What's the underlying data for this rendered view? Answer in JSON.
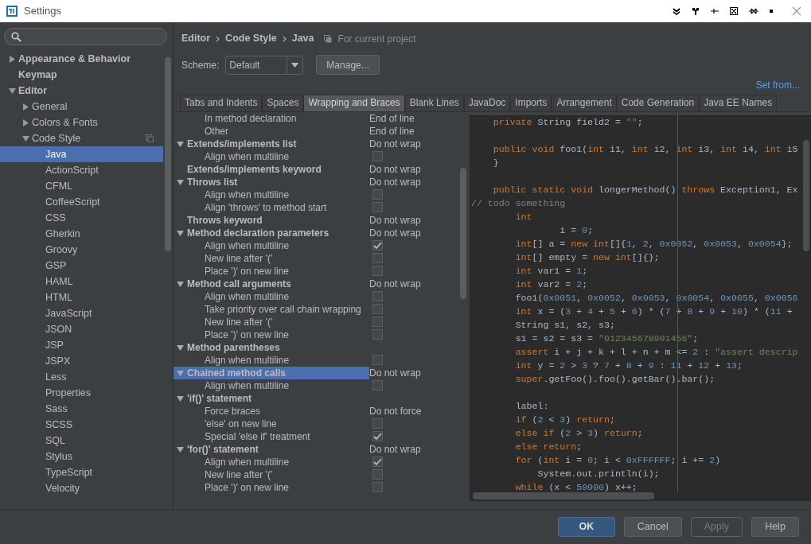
{
  "window": {
    "title": "Settings"
  },
  "sidebar": {
    "items": [
      {
        "label": "Appearance & Behavior",
        "expanded": false,
        "selected": false
      },
      {
        "label": "Keymap",
        "selected": false
      },
      {
        "label": "Editor",
        "expanded": true,
        "selected": false,
        "children": [
          {
            "label": "General",
            "expanded": false,
            "selected": false
          },
          {
            "label": "Colors & Fonts",
            "expanded": false,
            "selected": false
          },
          {
            "label": "Code Style",
            "expanded": true,
            "per_project": true,
            "selected": false,
            "children": [
              {
                "label": "Java",
                "selected": true
              },
              {
                "label": "ActionScript",
                "selected": false
              },
              {
                "label": "CFML",
                "selected": false
              },
              {
                "label": "CoffeeScript",
                "selected": false
              },
              {
                "label": "CSS",
                "selected": false
              },
              {
                "label": "Gherkin",
                "selected": false
              },
              {
                "label": "Groovy",
                "selected": false
              },
              {
                "label": "GSP",
                "selected": false
              },
              {
                "label": "HAML",
                "selected": false
              },
              {
                "label": "HTML",
                "selected": false
              },
              {
                "label": "JavaScript",
                "selected": false
              },
              {
                "label": "JSON",
                "selected": false
              },
              {
                "label": "JSP",
                "selected": false
              },
              {
                "label": "JSPX",
                "selected": false
              },
              {
                "label": "Less",
                "selected": false
              },
              {
                "label": "Properties",
                "selected": false
              },
              {
                "label": "Sass",
                "selected": false
              },
              {
                "label": "SCSS",
                "selected": false
              },
              {
                "label": "SQL",
                "selected": false
              },
              {
                "label": "Stylus",
                "selected": false
              },
              {
                "label": "TypeScript",
                "selected": false
              },
              {
                "label": "Velocity",
                "selected": false
              }
            ]
          }
        ]
      }
    ]
  },
  "breadcrumb": [
    "Editor",
    "Code Style",
    "Java"
  ],
  "scope_note": "For current project",
  "scheme": {
    "label": "Scheme:",
    "value": "Default",
    "manage_button": "Manage..."
  },
  "set_from_link": "Set from...",
  "tabs": [
    {
      "label": "Tabs and Indents",
      "selected": false
    },
    {
      "label": "Spaces",
      "selected": false
    },
    {
      "label": "Wrapping and Braces",
      "selected": true
    },
    {
      "label": "Blank Lines",
      "selected": false
    },
    {
      "label": "JavaDoc",
      "selected": false
    },
    {
      "label": "Imports",
      "selected": false
    },
    {
      "label": "Arrangement",
      "selected": false
    },
    {
      "label": "Code Generation",
      "selected": false
    },
    {
      "label": "Java EE Names",
      "selected": false
    }
  ],
  "wrapping_options": [
    {
      "children": [
        {
          "label": "In method declaration",
          "kind": "choice",
          "value": "End of line",
          "selected": false
        },
        {
          "label": "Other",
          "kind": "choice",
          "value": "End of line",
          "selected": false
        }
      ]
    },
    {
      "label": "Extends/implements list",
      "value": "Do not wrap",
      "expanded": true,
      "selected": false,
      "children": [
        {
          "label": "Align when multiline",
          "kind": "checkbox",
          "checked": false,
          "selected": false
        }
      ]
    },
    {
      "label": "Extends/implements keyword",
      "value": "Do not wrap",
      "selected": false
    },
    {
      "label": "Throws list",
      "value": "Do not wrap",
      "expanded": true,
      "selected": false,
      "children": [
        {
          "label": "Align when multiline",
          "kind": "checkbox",
          "checked": false,
          "selected": false
        },
        {
          "label": "Align 'throws' to method start",
          "kind": "checkbox",
          "checked": false,
          "selected": false
        }
      ]
    },
    {
      "label": "Throws keyword",
      "value": "Do not wrap",
      "selected": false
    },
    {
      "label": "Method declaration parameters",
      "value": "Do not wrap",
      "expanded": true,
      "selected": false,
      "children": [
        {
          "label": "Align when multiline",
          "kind": "checkbox",
          "checked": true,
          "selected": false
        },
        {
          "label": "New line after '('",
          "kind": "checkbox",
          "checked": false,
          "selected": false
        },
        {
          "label": "Place ')' on new line",
          "kind": "checkbox",
          "checked": false,
          "selected": false
        }
      ]
    },
    {
      "label": "Method call arguments",
      "value": "Do not wrap",
      "expanded": true,
      "selected": false,
      "children": [
        {
          "label": "Align when multiline",
          "kind": "checkbox",
          "checked": false,
          "selected": false
        },
        {
          "label": "Take priority over call chain wrapping",
          "kind": "checkbox",
          "checked": false,
          "selected": false
        },
        {
          "label": "New line after '('",
          "kind": "checkbox",
          "checked": false,
          "selected": false
        },
        {
          "label": "Place ')' on new line",
          "kind": "checkbox",
          "checked": false,
          "selected": false
        }
      ]
    },
    {
      "label": "Method parentheses",
      "expanded": true,
      "selected": false,
      "children": [
        {
          "label": "Align when multiline",
          "kind": "checkbox",
          "checked": false,
          "selected": false
        }
      ]
    },
    {
      "label": "Chained method calls",
      "value": "Do not wrap",
      "expanded": true,
      "selected": true,
      "children": [
        {
          "label": "Align when multiline",
          "kind": "checkbox",
          "checked": false,
          "selected": false
        }
      ]
    },
    {
      "label": "'if()' statement",
      "expanded": true,
      "selected": false,
      "children": [
        {
          "label": "Force braces",
          "kind": "choice",
          "value": "Do not force",
          "selected": false
        },
        {
          "label": "'else' on new line",
          "kind": "checkbox",
          "checked": false,
          "selected": false
        },
        {
          "label": "Special 'else if' treatment",
          "kind": "checkbox",
          "checked": true,
          "selected": false
        }
      ]
    },
    {
      "label": "'for()' statement",
      "value": "Do not wrap",
      "expanded": true,
      "selected": false,
      "children": [
        {
          "label": "Align when multiline",
          "kind": "checkbox",
          "checked": true,
          "selected": false
        },
        {
          "label": "New line after '('",
          "kind": "checkbox",
          "checked": false,
          "selected": false
        },
        {
          "label": "Place ')' on new line",
          "kind": "checkbox",
          "checked": false,
          "selected": false
        }
      ]
    }
  ],
  "code_preview": [
    {
      "kind": "code",
      "tokens": [
        {
          "kind": "keyword",
          "text": "    private"
        },
        {
          "kind": "plain",
          "text": " String field2 = "
        },
        {
          "kind": "string",
          "text": "\"\""
        },
        {
          "kind": "plain",
          "text": ";"
        }
      ]
    },
    {
      "kind": "blank"
    },
    {
      "kind": "code",
      "tokens": [
        {
          "kind": "keyword",
          "text": "    public void"
        },
        {
          "kind": "plain",
          "text": " foo1("
        },
        {
          "kind": "keyword",
          "text": "int"
        },
        {
          "kind": "plain",
          "text": " i1, "
        },
        {
          "kind": "keyword",
          "text": "int"
        },
        {
          "kind": "plain",
          "text": " i2, "
        },
        {
          "kind": "keyword",
          "text": "int"
        },
        {
          "kind": "plain",
          "text": " i3, "
        },
        {
          "kind": "keyword",
          "text": "int"
        },
        {
          "kind": "plain",
          "text": " i4, "
        },
        {
          "kind": "keyword",
          "text": "int"
        },
        {
          "kind": "plain",
          "text": " i5"
        }
      ]
    },
    {
      "kind": "code",
      "tokens": [
        {
          "kind": "plain",
          "text": "    }"
        }
      ]
    },
    {
      "kind": "blank"
    },
    {
      "kind": "code",
      "tokens": [
        {
          "kind": "keyword",
          "text": "    public static void"
        },
        {
          "kind": "plain",
          "text": " longerMethod() "
        },
        {
          "kind": "keyword",
          "text": "throws"
        },
        {
          "kind": "plain",
          "text": " Exception1, Ex"
        }
      ]
    },
    {
      "kind": "code",
      "tokens": [
        {
          "kind": "comment",
          "text": "// todo something"
        }
      ]
    },
    {
      "kind": "code",
      "tokens": [
        {
          "kind": "keyword",
          "text": "        int"
        }
      ]
    },
    {
      "kind": "code",
      "tokens": [
        {
          "kind": "plain",
          "text": "                i = "
        },
        {
          "kind": "number",
          "text": "0"
        },
        {
          "kind": "plain",
          "text": ";"
        }
      ]
    },
    {
      "kind": "code",
      "tokens": [
        {
          "kind": "keyword",
          "text": "        int"
        },
        {
          "kind": "plain",
          "text": "[] a = "
        },
        {
          "kind": "keyword",
          "text": "new int"
        },
        {
          "kind": "plain",
          "text": "[]{"
        },
        {
          "kind": "number",
          "text": "1"
        },
        {
          "kind": "plain",
          "text": ", "
        },
        {
          "kind": "number",
          "text": "2"
        },
        {
          "kind": "plain",
          "text": ", "
        },
        {
          "kind": "number",
          "text": "0x0052"
        },
        {
          "kind": "plain",
          "text": ", "
        },
        {
          "kind": "number",
          "text": "0x0053"
        },
        {
          "kind": "plain",
          "text": ", "
        },
        {
          "kind": "number",
          "text": "0x0054"
        },
        {
          "kind": "plain",
          "text": "};"
        }
      ]
    },
    {
      "kind": "code",
      "tokens": [
        {
          "kind": "keyword",
          "text": "        int"
        },
        {
          "kind": "plain",
          "text": "[] empty = "
        },
        {
          "kind": "keyword",
          "text": "new int"
        },
        {
          "kind": "plain",
          "text": "[]{};"
        }
      ]
    },
    {
      "kind": "code",
      "tokens": [
        {
          "kind": "keyword",
          "text": "        int"
        },
        {
          "kind": "plain",
          "text": " var1 = "
        },
        {
          "kind": "number",
          "text": "1"
        },
        {
          "kind": "plain",
          "text": ";"
        }
      ]
    },
    {
      "kind": "code",
      "tokens": [
        {
          "kind": "keyword",
          "text": "        int"
        },
        {
          "kind": "plain",
          "text": " var2 = "
        },
        {
          "kind": "number",
          "text": "2"
        },
        {
          "kind": "plain",
          "text": ";"
        }
      ]
    },
    {
      "kind": "code",
      "tokens": [
        {
          "kind": "plain",
          "text": "        foo1("
        },
        {
          "kind": "number",
          "text": "0x0051"
        },
        {
          "kind": "plain",
          "text": ", "
        },
        {
          "kind": "number",
          "text": "0x0052"
        },
        {
          "kind": "plain",
          "text": ", "
        },
        {
          "kind": "number",
          "text": "0x0053"
        },
        {
          "kind": "plain",
          "text": ", "
        },
        {
          "kind": "number",
          "text": "0x0054"
        },
        {
          "kind": "plain",
          "text": ", "
        },
        {
          "kind": "number",
          "text": "0x0055"
        },
        {
          "kind": "plain",
          "text": ", "
        },
        {
          "kind": "number",
          "text": "0x0056"
        }
      ]
    },
    {
      "kind": "code",
      "tokens": [
        {
          "kind": "keyword",
          "text": "        int"
        },
        {
          "kind": "plain",
          "text": " x = ("
        },
        {
          "kind": "number",
          "text": "3"
        },
        {
          "kind": "plain",
          "text": " + "
        },
        {
          "kind": "number",
          "text": "4"
        },
        {
          "kind": "plain",
          "text": " + "
        },
        {
          "kind": "number",
          "text": "5"
        },
        {
          "kind": "plain",
          "text": " + "
        },
        {
          "kind": "number",
          "text": "6"
        },
        {
          "kind": "plain",
          "text": ") * ("
        },
        {
          "kind": "number",
          "text": "7"
        },
        {
          "kind": "plain",
          "text": " + "
        },
        {
          "kind": "number",
          "text": "8"
        },
        {
          "kind": "plain",
          "text": " + "
        },
        {
          "kind": "number",
          "text": "9"
        },
        {
          "kind": "plain",
          "text": " + "
        },
        {
          "kind": "number",
          "text": "10"
        },
        {
          "kind": "plain",
          "text": ") * ("
        },
        {
          "kind": "number",
          "text": "11"
        },
        {
          "kind": "plain",
          "text": " +"
        }
      ]
    },
    {
      "kind": "code",
      "tokens": [
        {
          "kind": "plain",
          "text": "        String s1, s2, s3;"
        }
      ]
    },
    {
      "kind": "code",
      "tokens": [
        {
          "kind": "plain",
          "text": "        s1 = s2 = s3 = "
        },
        {
          "kind": "string",
          "text": "\"012345678901456\""
        },
        {
          "kind": "plain",
          "text": ";"
        }
      ]
    },
    {
      "kind": "code",
      "tokens": [
        {
          "kind": "keyword",
          "text": "        assert"
        },
        {
          "kind": "plain",
          "text": " i + j + k + l + n + m <= "
        },
        {
          "kind": "number",
          "text": "2"
        },
        {
          "kind": "plain",
          "text": " : "
        },
        {
          "kind": "string",
          "text": "\"assert descrip"
        }
      ]
    },
    {
      "kind": "code",
      "tokens": [
        {
          "kind": "keyword",
          "text": "        int"
        },
        {
          "kind": "plain",
          "text": " y = "
        },
        {
          "kind": "number",
          "text": "2"
        },
        {
          "kind": "plain",
          "text": " > "
        },
        {
          "kind": "number",
          "text": "3"
        },
        {
          "kind": "plain",
          "text": " ? "
        },
        {
          "kind": "number",
          "text": "7"
        },
        {
          "kind": "plain",
          "text": " + "
        },
        {
          "kind": "number",
          "text": "8"
        },
        {
          "kind": "plain",
          "text": " + "
        },
        {
          "kind": "number",
          "text": "9"
        },
        {
          "kind": "plain",
          "text": " : "
        },
        {
          "kind": "number",
          "text": "11"
        },
        {
          "kind": "plain",
          "text": " + "
        },
        {
          "kind": "number",
          "text": "12"
        },
        {
          "kind": "plain",
          "text": " + "
        },
        {
          "kind": "number",
          "text": "13"
        },
        {
          "kind": "plain",
          "text": ";"
        }
      ]
    },
    {
      "kind": "code",
      "tokens": [
        {
          "kind": "keyword",
          "text": "        super"
        },
        {
          "kind": "plain",
          "text": ".getFoo().foo().getBar().bar();"
        }
      ]
    },
    {
      "kind": "blank"
    },
    {
      "kind": "code",
      "tokens": [
        {
          "kind": "plain",
          "text": "        label:"
        }
      ]
    },
    {
      "kind": "code",
      "tokens": [
        {
          "kind": "keyword",
          "text": "        if"
        },
        {
          "kind": "plain",
          "text": " ("
        },
        {
          "kind": "number",
          "text": "2"
        },
        {
          "kind": "plain",
          "text": " < "
        },
        {
          "kind": "number",
          "text": "3"
        },
        {
          "kind": "plain",
          "text": ") "
        },
        {
          "kind": "keyword",
          "text": "return"
        },
        {
          "kind": "plain",
          "text": ";"
        }
      ]
    },
    {
      "kind": "code",
      "tokens": [
        {
          "kind": "keyword",
          "text": "        else if"
        },
        {
          "kind": "plain",
          "text": " ("
        },
        {
          "kind": "number",
          "text": "2"
        },
        {
          "kind": "plain",
          "text": " > "
        },
        {
          "kind": "number",
          "text": "3"
        },
        {
          "kind": "plain",
          "text": ") "
        },
        {
          "kind": "keyword",
          "text": "return"
        },
        {
          "kind": "plain",
          "text": ";"
        }
      ]
    },
    {
      "kind": "code",
      "tokens": [
        {
          "kind": "keyword",
          "text": "        else return"
        },
        {
          "kind": "plain",
          "text": ";"
        }
      ]
    },
    {
      "kind": "code",
      "tokens": [
        {
          "kind": "keyword",
          "text": "        for"
        },
        {
          "kind": "plain",
          "text": " ("
        },
        {
          "kind": "keyword",
          "text": "int"
        },
        {
          "kind": "plain",
          "text": " i = "
        },
        {
          "kind": "number",
          "text": "0"
        },
        {
          "kind": "plain",
          "text": "; i < "
        },
        {
          "kind": "number",
          "text": "0xFFFFFF"
        },
        {
          "kind": "plain",
          "text": "; i += "
        },
        {
          "kind": "number",
          "text": "2"
        },
        {
          "kind": "plain",
          "text": ")"
        }
      ]
    },
    {
      "kind": "code",
      "tokens": [
        {
          "kind": "plain",
          "text": "            System.out.println(i);"
        }
      ]
    },
    {
      "kind": "code",
      "tokens": [
        {
          "kind": "keyword",
          "text": "        while"
        },
        {
          "kind": "plain",
          "text": " (x < "
        },
        {
          "kind": "number",
          "text": "50000"
        },
        {
          "kind": "plain",
          "text": ") x++;"
        }
      ]
    }
  ],
  "buttons": [
    {
      "label": "OK",
      "kind": "default",
      "disabled": false
    },
    {
      "label": "Cancel",
      "kind": "normal",
      "disabled": false
    },
    {
      "label": "Apply",
      "kind": "normal",
      "disabled": true
    },
    {
      "label": "Help",
      "kind": "normal",
      "disabled": false
    }
  ]
}
